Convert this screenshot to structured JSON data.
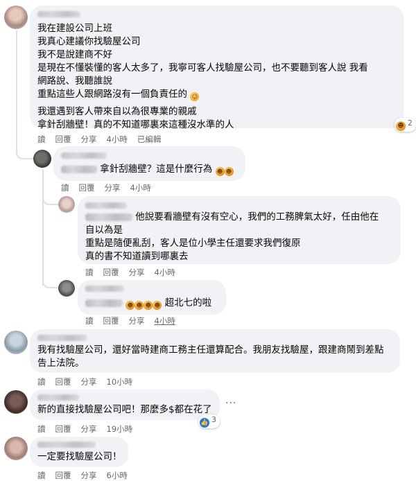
{
  "comments": [
    {
      "lines": [
        "我在建設公司上班",
        "我真心建議你找驗屋公司",
        "我不是說建商不好",
        "是現在不懂裝懂的客人太多了，我寧可客人找驗屋公司，也不要聽到客人說 我看",
        "網路說、我聽誰說",
        "重點這些人跟網路沒有一個負責任的",
        "我還遇到客人帶來自以為很專業的親戚",
        "拿針刮牆壁！真的不知道哪裏來這種沒水準的人"
      ],
      "actions": {
        "read": "讀",
        "reply": "回覆",
        "share": "分享",
        "time": "4小時",
        "edited": "已編輯"
      },
      "reaction_count": "2",
      "reaction_icon": "haha-icon"
    },
    {
      "text": "拿針刮牆壁？這是什麼行為",
      "actions": {
        "read": "讀",
        "reply": "回覆",
        "share": "分享",
        "time": "4小時"
      }
    },
    {
      "lines": [
        "他說要看牆壁有沒有空心，我們的工務脾氣太好，任由他在",
        "自以為是",
        "重點是隨便亂刮，客人是位小學主任還要求我們復原",
        "真的書不知道讀到哪裏去"
      ],
      "actions": {
        "read": "讀",
        "reply": "回覆",
        "share": "分享",
        "time": "4小時"
      }
    },
    {
      "text": "超北七的啦",
      "actions": {
        "read": "讀",
        "reply": "回覆",
        "share": "分享",
        "time": "4小時"
      }
    },
    {
      "lines": [
        "我有找驗屋公司，還好當時建商工務主任還算配合。我朋友找驗屋，跟建商鬧到差點",
        "告上法院。"
      ],
      "actions": {
        "read": "讀",
        "reply": "回覆",
        "share": "分享",
        "time": "10小時"
      }
    },
    {
      "text": "新的直接找驗屋公司吧！那麼多$都在花了",
      "actions": {
        "read": "讀",
        "reply": "回覆",
        "share": "分享",
        "time": "19小時"
      },
      "reaction_count": "3",
      "reaction_icon": "like-icon",
      "more": "···"
    },
    {
      "text": "一定要找驗屋公司！",
      "actions": {
        "read": "讀",
        "reply": "回覆",
        "share": "分享",
        "time": "6小時"
      }
    }
  ],
  "colors": {
    "bubble": "#f0f2f5",
    "meta": "#65676b",
    "like": "#1877f2"
  }
}
